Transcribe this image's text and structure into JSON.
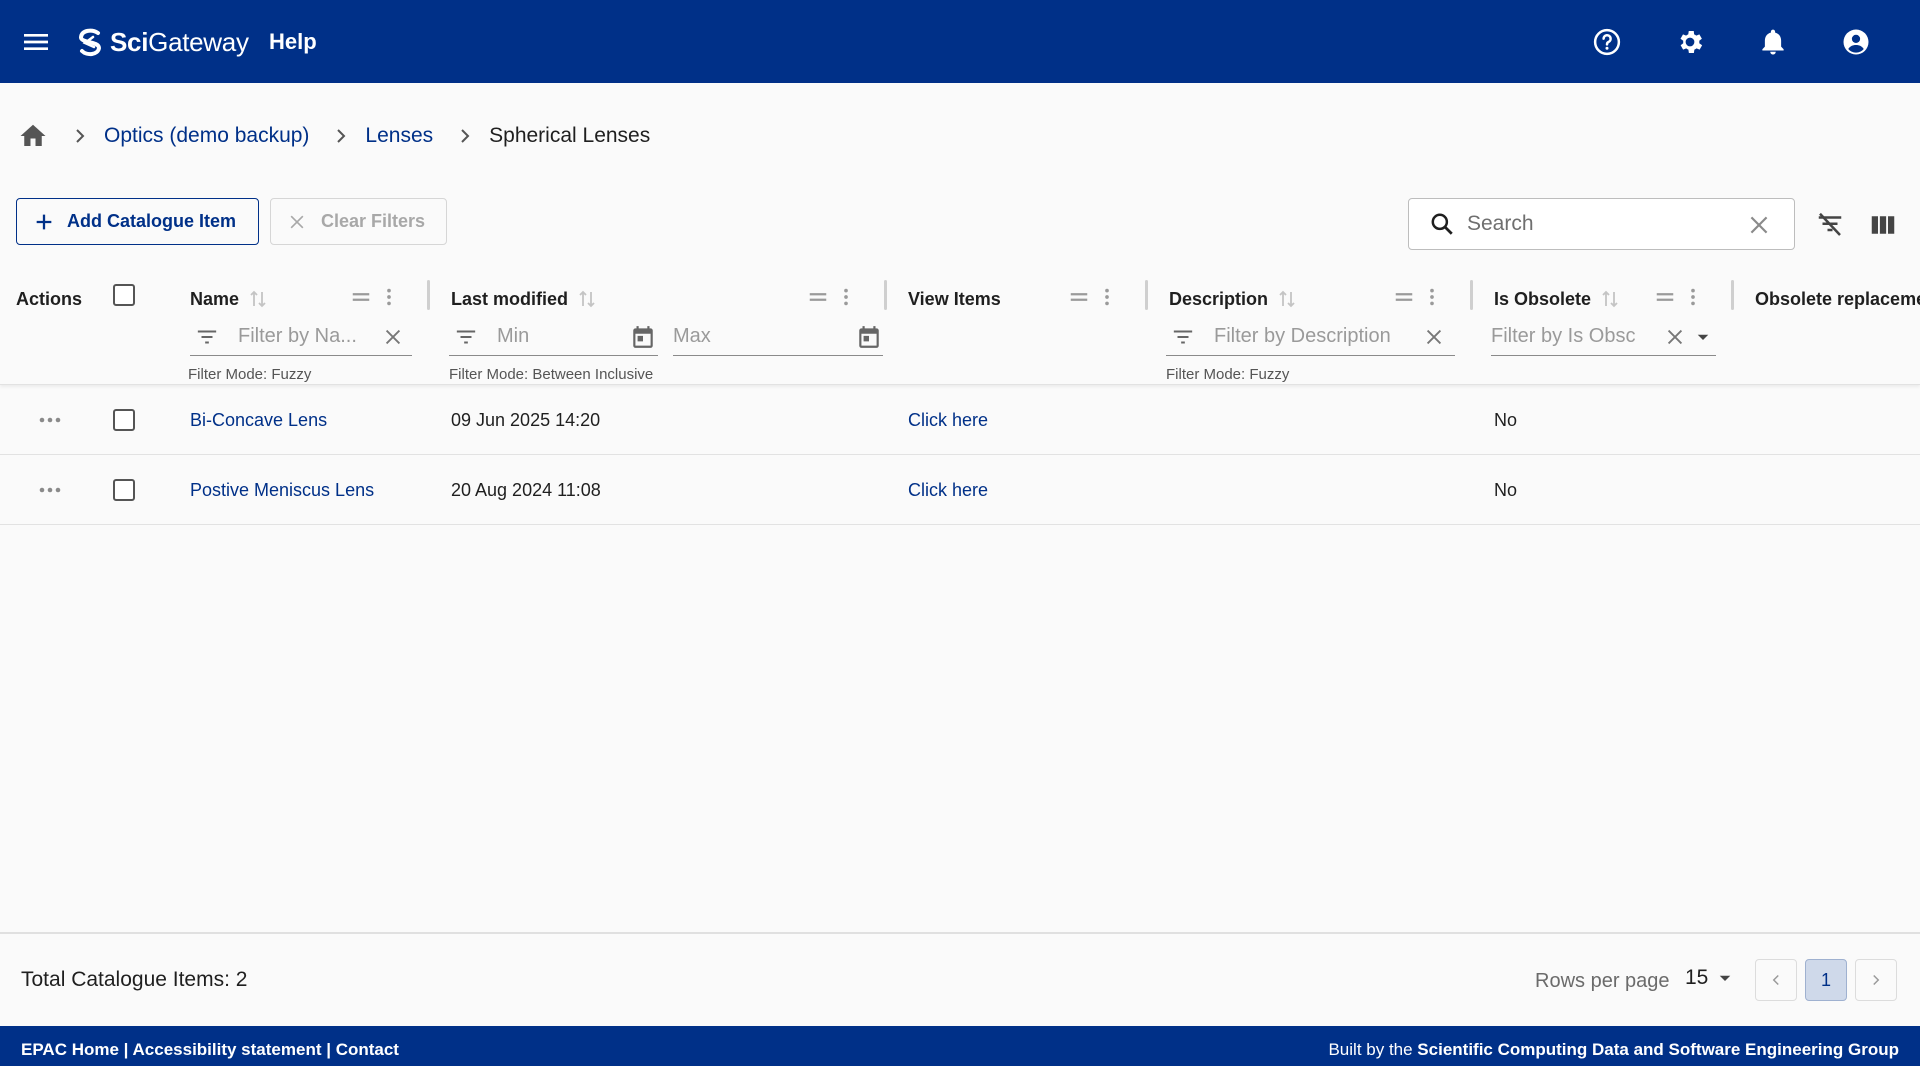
{
  "appbar": {
    "brand_bold": "Sci",
    "brand_rest": "Gateway",
    "help_label": "Help",
    "colors": {
      "bar": "#003088",
      "footer": "#003088"
    }
  },
  "breadcrumb": {
    "items": [
      "Optics (demo backup)",
      "Lenses"
    ],
    "current": "Spherical Lenses"
  },
  "toolbar": {
    "add_label": "Add Catalogue Item",
    "clear_label": "Clear Filters",
    "search_placeholder": "Search"
  },
  "table": {
    "columns": {
      "actions": "Actions",
      "name": "Name",
      "last_modified": "Last modified",
      "view_items": "View Items",
      "description": "Description",
      "is_obsolete": "Is Obsolete",
      "obsolete_replacement": "Obsolete replaceme"
    },
    "filters": {
      "name_placeholder": "Filter by Na...",
      "min_placeholder": "Min",
      "max_placeholder": "Max",
      "description_placeholder": "Filter by Description",
      "obsolete_placeholder": "Filter by Is Obsc",
      "mode_fuzzy": "Filter Mode: Fuzzy",
      "mode_between": "Filter Mode: Between Inclusive",
      "mode_fuzzy_desc": "Filter Mode: Fuzzy"
    },
    "rows": [
      {
        "name": "Bi-Concave Lens",
        "last_modified": "09 Jun 2025 14:20",
        "view": "Click here",
        "description": "",
        "is_obsolete": "No"
      },
      {
        "name": "Postive Meniscus Lens",
        "last_modified": "20 Aug 2024 11:08",
        "view": "Click here",
        "description": "",
        "is_obsolete": "No"
      }
    ]
  },
  "pagination": {
    "total_label": "Total Catalogue Items: 2",
    "rows_per_page_label": "Rows per page",
    "rows_per_page_value": "15",
    "current_page": "1"
  },
  "footer": {
    "link_home": "EPAC Home",
    "link_accessibility": "Accessibility statement",
    "link_contact": "Contact",
    "built_by_prefix": "Built by the ",
    "built_by_org": "Scientific Computing Data and Software Engineering Group"
  }
}
